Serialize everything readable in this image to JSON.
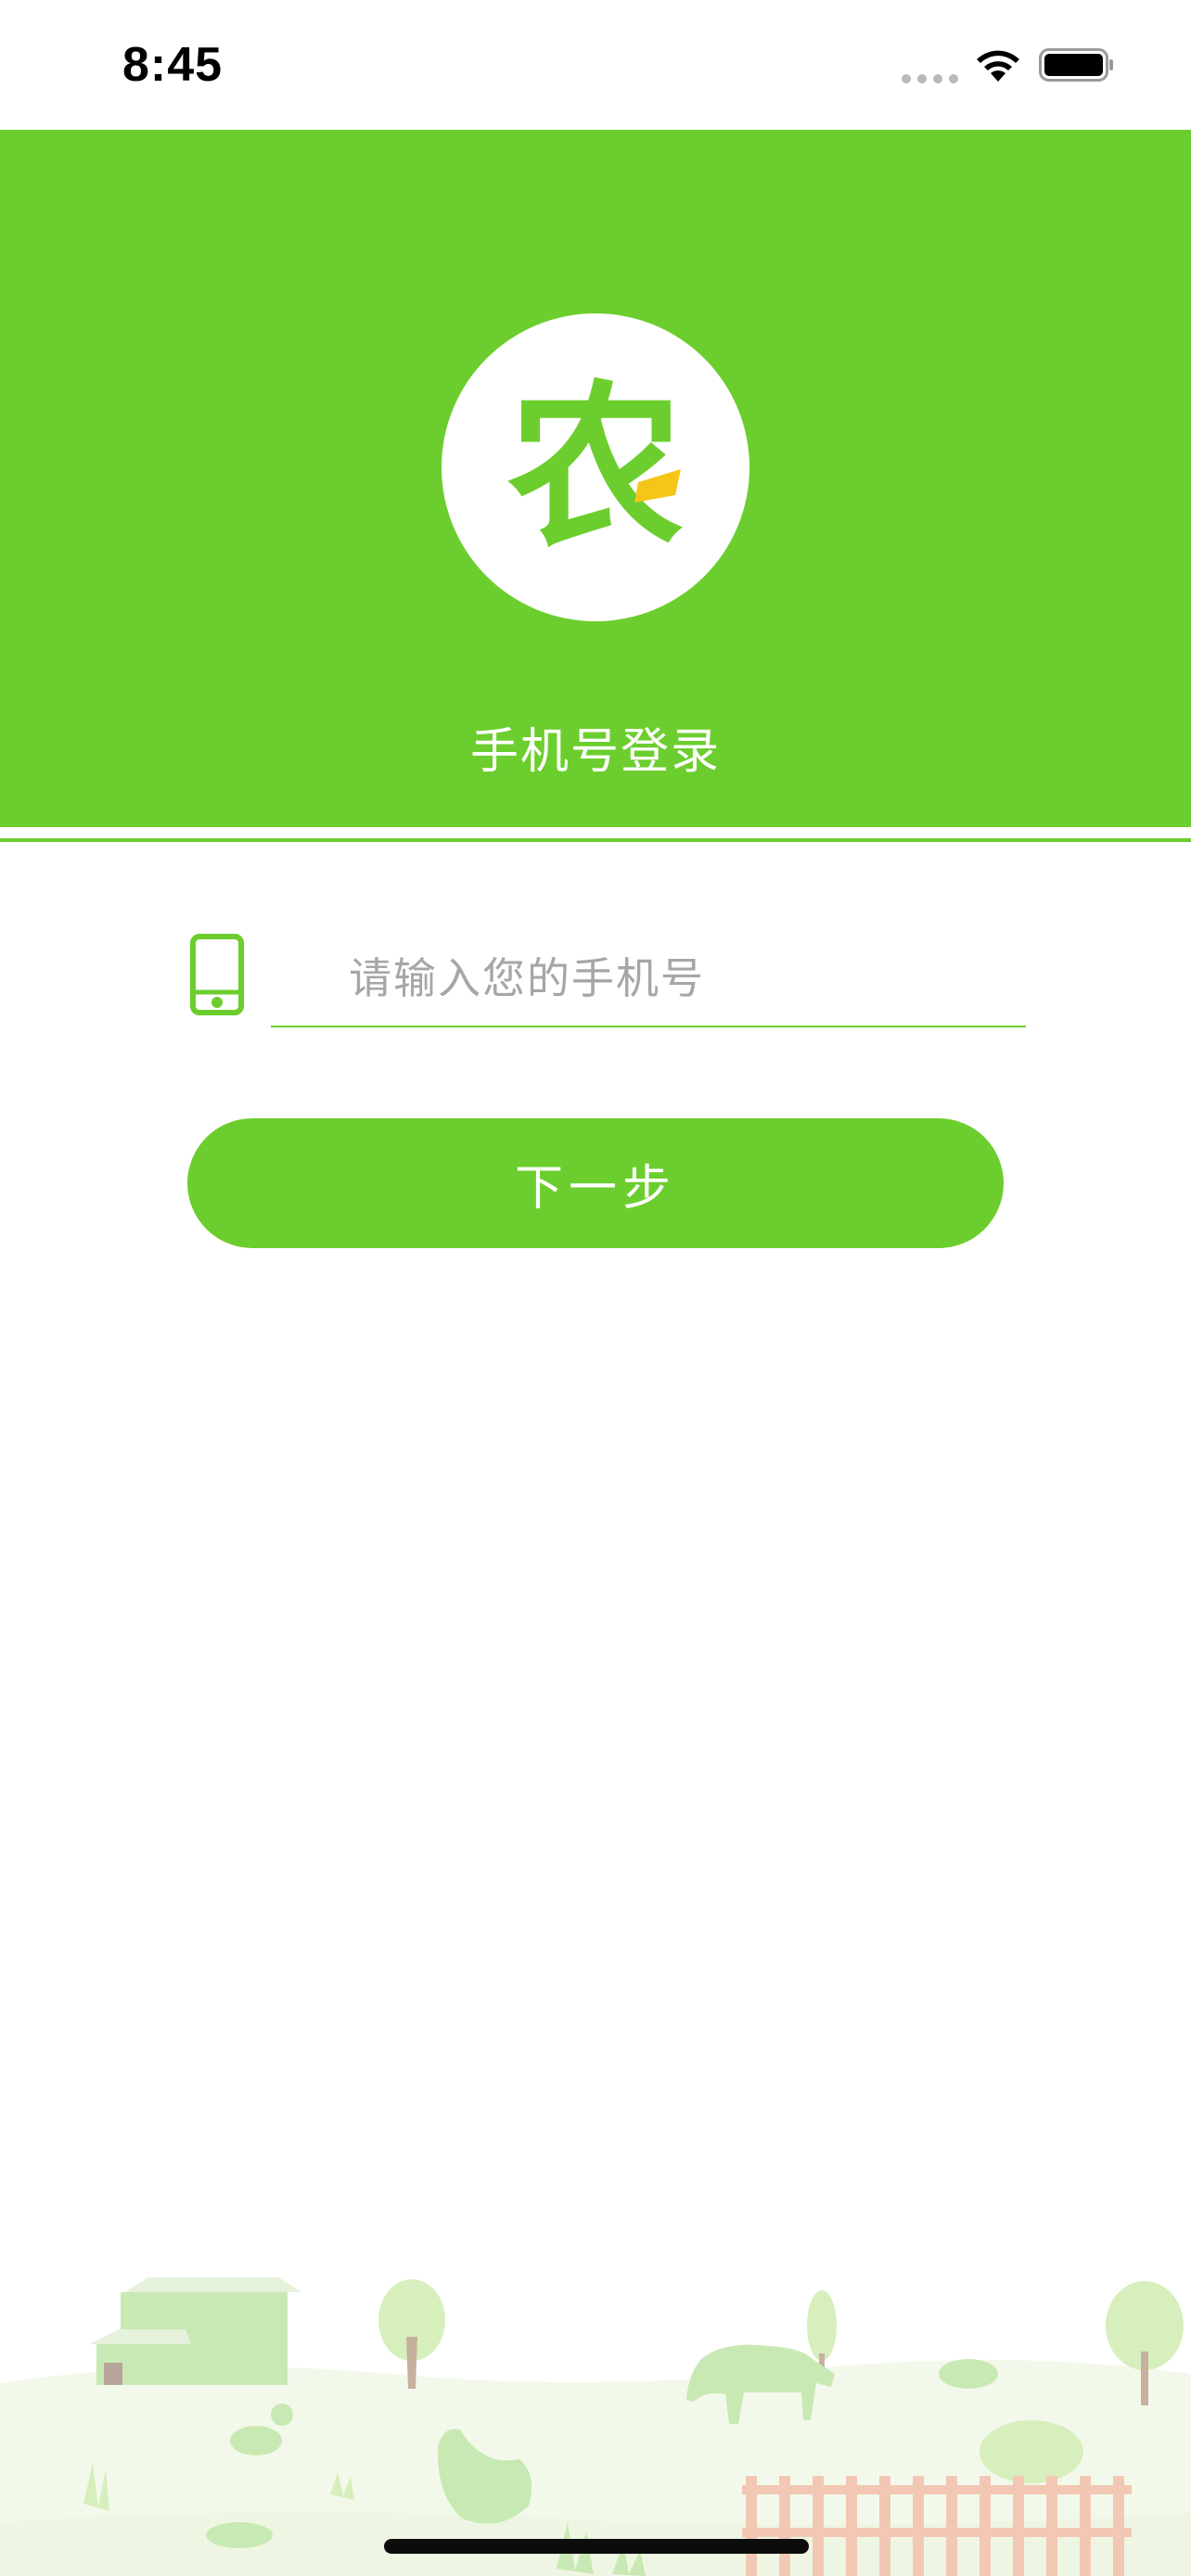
{
  "status_bar": {
    "time": "8:45",
    "icons": [
      "signal-icon",
      "wifi-icon",
      "battery-icon"
    ]
  },
  "header": {
    "logo_glyph": "农",
    "logo_icon": "nong-logo-icon",
    "title": "手机号登录"
  },
  "form": {
    "phone_icon": "mobile-phone-icon",
    "phone_placeholder": "请输入您的手机号",
    "phone_value": "",
    "next_label": "下一步"
  },
  "footer": {
    "illustration": "farm-illustration"
  },
  "colors": {
    "brand_green": "#6cce2e",
    "logo_accent": "#f5c518",
    "placeholder_gray": "#a6a6a6",
    "background": "#ffffff"
  }
}
